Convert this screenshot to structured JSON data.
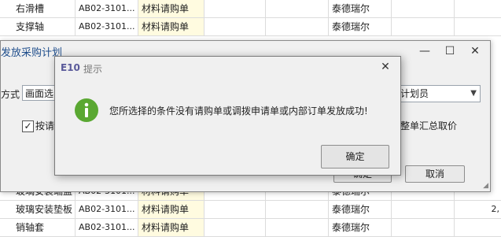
{
  "grid": {
    "top_rows": [
      {
        "name": "右滑槽",
        "code": "AB02-3101...",
        "type": "材料请购单",
        "supplier": "泰德瑞尔",
        "extra": ""
      },
      {
        "name": "支撑轴",
        "code": "AB02-3101...",
        "type": "材料请购单",
        "supplier": "泰德瑞尔",
        "extra": ""
      }
    ],
    "bottom_rows": [
      {
        "name": "玻璃安装端盖",
        "code": "AB02-3101...",
        "type": "材料请购单",
        "supplier": "泰德瑞尔",
        "extra": ""
      },
      {
        "name": "玻璃安装垫板",
        "code": "AB02-3101...",
        "type": "材料请购单",
        "supplier": "泰德瑞尔",
        "extra": "2,"
      },
      {
        "name": "销轴套",
        "code": "AB02-3101...",
        "type": "材料请购单",
        "supplier": "泰德瑞尔",
        "extra": ""
      }
    ]
  },
  "outer_dialog": {
    "title": "发放采购计划",
    "method_label": "方式",
    "method_value": "画面选",
    "planner_value": "计划员",
    "checkbox_label": "按请",
    "checkbox_mark": "✓",
    "summary_label": "整单汇总取价",
    "confirm_label": "确定",
    "cancel_label": "取消",
    "min_icon": "—",
    "max_icon": "☐",
    "close_icon": "✕"
  },
  "prompt_dialog": {
    "logo": "E10",
    "title": "提示",
    "close_icon": "✕",
    "message": "您所选择的条件没有请购单或调拨申请单或内部订单发放成功!",
    "ok_label": "确定"
  },
  "colors": {
    "info_green": "#5aa832",
    "type_column_bg": "#fffbe0",
    "title_blue": "#1f4e8c"
  }
}
